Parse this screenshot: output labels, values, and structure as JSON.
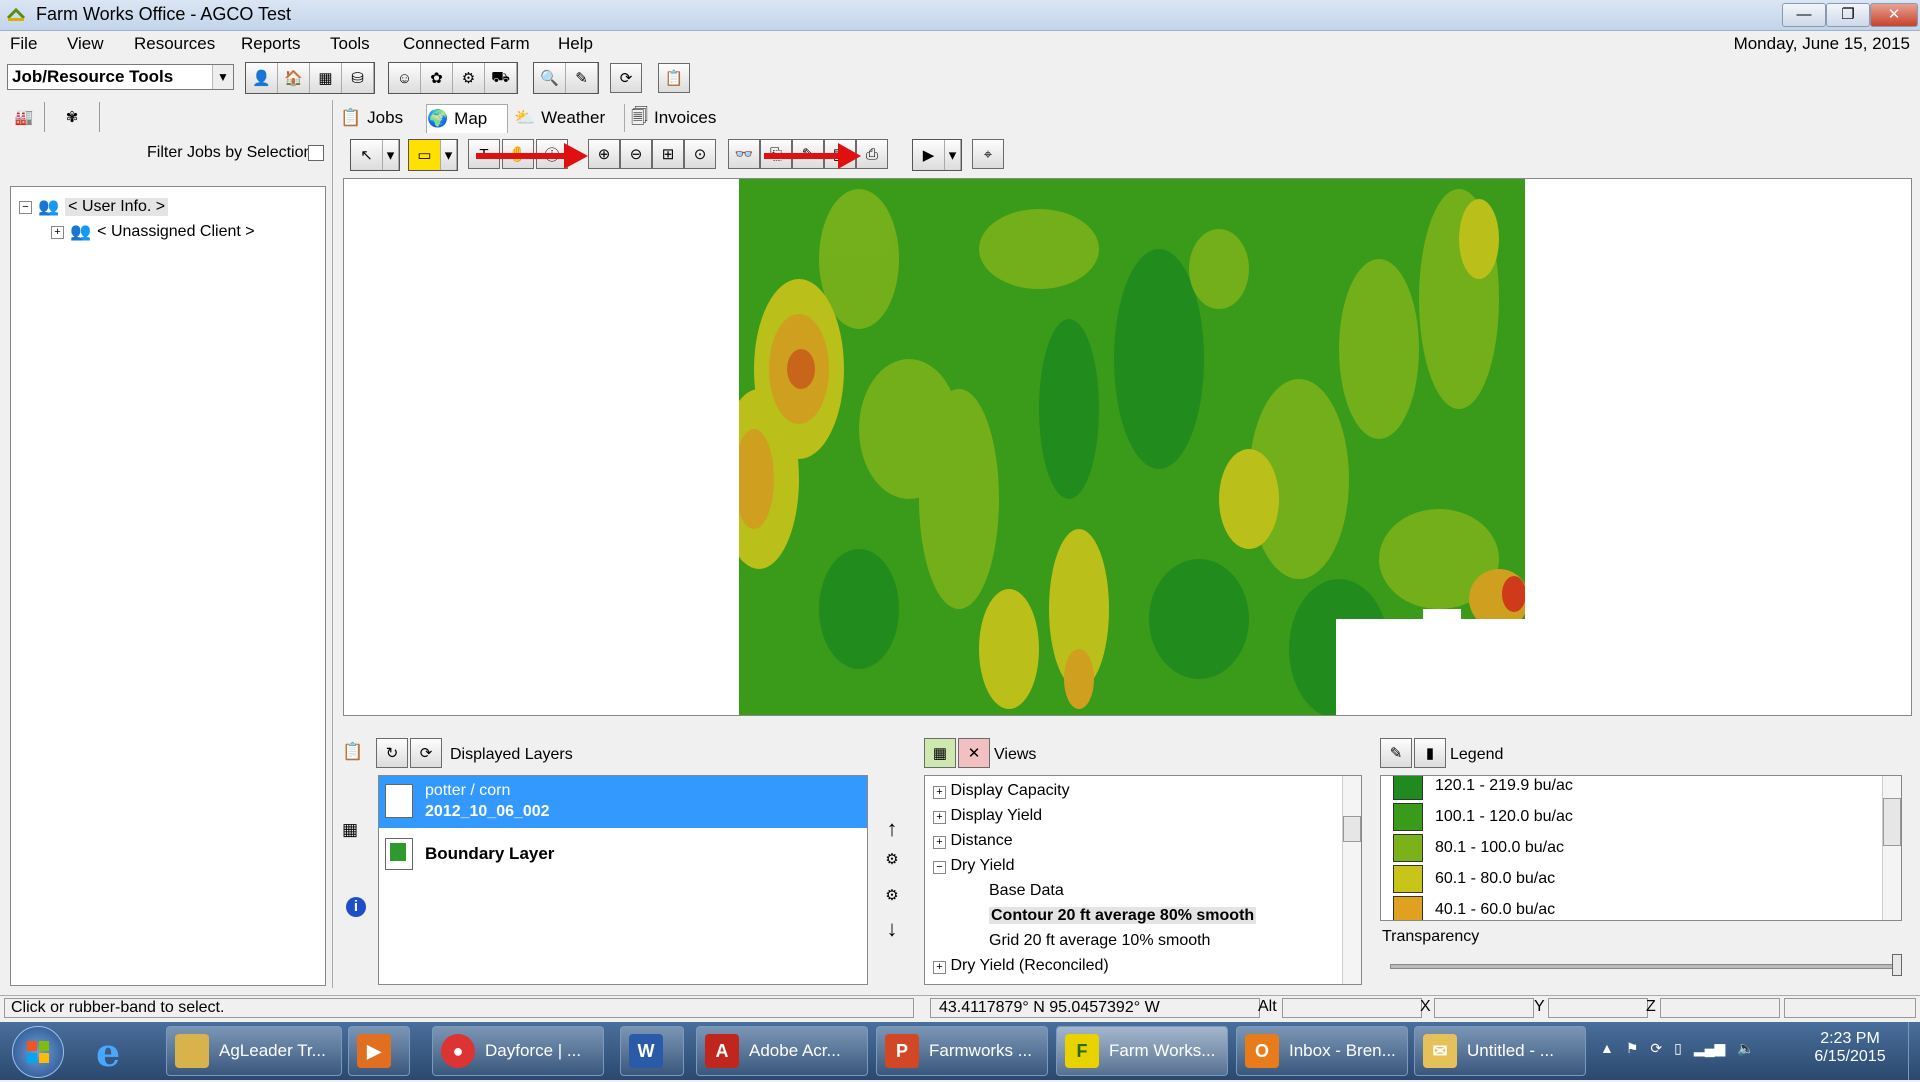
{
  "window": {
    "title": "Farm Works Office - AGCO Test",
    "buttons": [
      "—",
      "❐",
      "✕"
    ]
  },
  "menu": {
    "items": [
      "File",
      "View",
      "Resources",
      "Reports",
      "Tools",
      "Connected Farm",
      "Help"
    ],
    "date": "Monday, June 15, 2015"
  },
  "toolbar": {
    "selector_value": "Job/Resource Tools"
  },
  "left_panel": {
    "filter_label": "Filter Jobs by Selection",
    "tree": [
      {
        "label": "< User Info. >",
        "expander": "−"
      },
      {
        "label": "< Unassigned Client >",
        "expander": "+"
      }
    ]
  },
  "tabs": [
    "Jobs",
    "Map",
    "Weather",
    "Invoices"
  ],
  "layers": {
    "header": "Displayed Layers",
    "items": [
      {
        "line1": "potter / corn",
        "line2": "2012_10_06_002",
        "selected": true
      },
      {
        "line1": "Boundary Layer",
        "line2": "",
        "selected": false
      }
    ]
  },
  "views": {
    "header": "Views",
    "items": [
      {
        "label": "Display Capacity",
        "expander": "+",
        "indent": 0,
        "bold": false
      },
      {
        "label": "Display Yield",
        "expander": "+",
        "indent": 0,
        "bold": false
      },
      {
        "label": "Distance",
        "expander": "+",
        "indent": 0,
        "bold": false
      },
      {
        "label": "Dry Yield",
        "expander": "−",
        "indent": 0,
        "bold": false
      },
      {
        "label": "Base Data",
        "expander": "",
        "indent": 1,
        "bold": false
      },
      {
        "label": "Contour 20 ft average 80% smooth",
        "expander": "",
        "indent": 1,
        "bold": true
      },
      {
        "label": "Grid 20 ft average 10% smooth",
        "expander": "",
        "indent": 1,
        "bold": false
      },
      {
        "label": "Dry Yield (Reconciled)",
        "expander": "+",
        "indent": 0,
        "bold": false
      }
    ]
  },
  "legend": {
    "header": "Legend",
    "transparency_label": "Transparency",
    "items": [
      {
        "label": "120.1 - 219.9 bu/ac",
        "color": "#1f8a1f"
      },
      {
        "label": "100.1 - 120.0 bu/ac",
        "color": "#3a9a1a"
      },
      {
        "label": "80.1 - 100.0 bu/ac",
        "color": "#7ab21c"
      },
      {
        "label": "60.1 - 80.0 bu/ac",
        "color": "#c8c41a"
      },
      {
        "label": "40.1 - 60.0 bu/ac",
        "color": "#e0a020"
      }
    ]
  },
  "status": {
    "message": "Click or rubber-band to select.",
    "coords": "43.4117879° N   95.0457392° W",
    "alt_label": "Alt",
    "x_label": "X",
    "y_label": "Y",
    "z_label": "Z"
  },
  "taskbar": {
    "items": [
      {
        "label": "AgLeader Tr...",
        "icon_color": "#d8b24a",
        "icon": ""
      },
      {
        "label": "",
        "icon_color": "#e07020",
        "icon": "▶"
      },
      {
        "label": "Dayforce | ...",
        "icon_color": "#d33",
        "icon": "●"
      },
      {
        "label": "",
        "icon_color": "#2b5aa8",
        "icon": "W"
      },
      {
        "label": "Adobe Acr...",
        "icon_color": "#c0261e",
        "icon": "A"
      },
      {
        "label": "Farmworks ...",
        "icon_color": "#d24726",
        "icon": "P"
      },
      {
        "label": "Farm Works...",
        "icon_color": "#e8d300",
        "icon": "F"
      },
      {
        "label": "Inbox - Bren...",
        "icon_color": "#e87c1a",
        "icon": "O"
      },
      {
        "label": "Untitled - ...",
        "icon_color": "#e6c15a",
        "icon": "✉"
      }
    ],
    "time": "2:23 PM",
    "date": "6/15/2015"
  },
  "colors": {
    "selection": "#3399ff",
    "arrow": "#e01010"
  }
}
